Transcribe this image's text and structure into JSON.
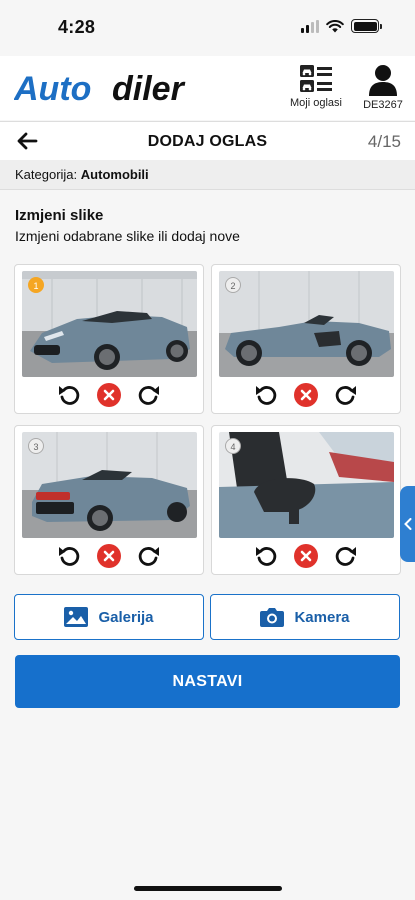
{
  "status": {
    "time": "4:28"
  },
  "header": {
    "logo_part1": "Auto",
    "logo_part2": "diler",
    "moji_oglasi_label": "Moji oglasi",
    "user_label": "DE3267"
  },
  "titlebar": {
    "title": "DODAJ OGLAS",
    "step": "4/15"
  },
  "category": {
    "label": "Kategorija:",
    "value": "Automobili"
  },
  "section": {
    "title": "Izmjeni slike",
    "subtitle": "Izmjeni odabrane slike ili dodaj nove"
  },
  "photos": [
    {
      "number": "1",
      "description": "blue convertible sports car front view"
    },
    {
      "number": "2",
      "description": "blue convertible sports car side view"
    },
    {
      "number": "3",
      "description": "blue convertible sports car rear view"
    },
    {
      "number": "4",
      "description": "convertible car side mirror close-up"
    }
  ],
  "buttons": {
    "gallery": "Galerija",
    "camera": "Kamera",
    "continue": "NASTAVI"
  },
  "colors": {
    "primary": "#1670cc",
    "outline": "#1a72c9",
    "delete": "#e0322b",
    "badge_first": "#f5a623",
    "car": "#6f8799"
  }
}
